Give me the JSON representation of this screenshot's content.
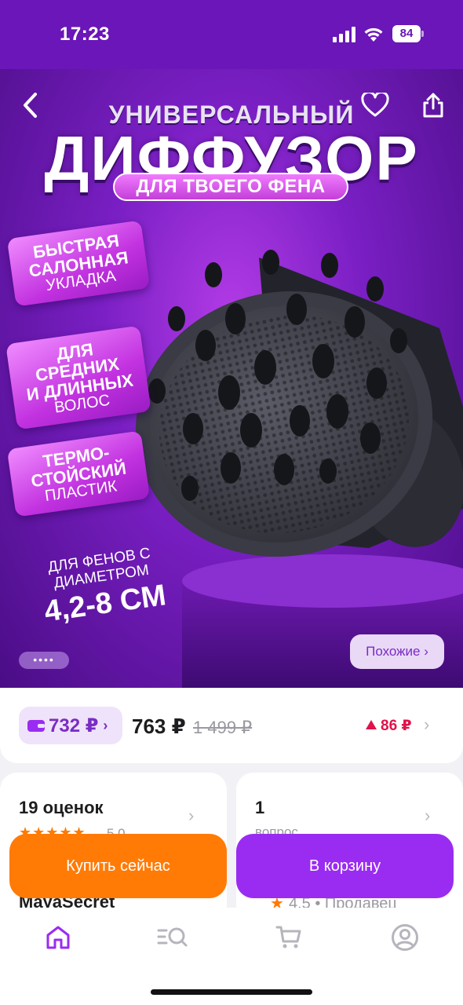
{
  "status_bar": {
    "time": "17:23",
    "battery": "84",
    "icons": [
      "cellular-signal-icon",
      "wifi-icon",
      "battery-icon"
    ]
  },
  "product_image": {
    "title_small": "УНИВЕРСАЛЬНЫЙ",
    "title_big": "ДИФФУЗОР",
    "title_pill": "ДЛЯ ТВОЕГО ФЕНА",
    "badges": [
      {
        "line1": "БЫСТРАЯ",
        "line2": "САЛОННАЯ",
        "line3": "УКЛАДКА"
      },
      {
        "line1": "ДЛЯ СРЕДНИХ",
        "line2": "И ДЛИННЫХ",
        "line3": "ВОЛОС"
      },
      {
        "line1": "ТЕРМО-",
        "line2": "СТОЙСКИЙ",
        "line3": "ПЛАСТИК"
      }
    ],
    "diameter_line1": "ДЛЯ ФЕНОВ С",
    "diameter_line2": "ДИАМЕТРОМ",
    "diameter_value": "4,2-8 СМ",
    "pager_dots": "••••",
    "similar_button": "Похожие ›"
  },
  "toolbar": {
    "back_icon": "back-arrow-icon",
    "favorite_icon": "heart-icon",
    "share_icon": "share-icon"
  },
  "price": {
    "wallet_price": "732 ₽",
    "price": "763 ₽",
    "old_price": "1 499 ₽",
    "rise": "86 ₽"
  },
  "reviews": {
    "count": "19 оценок",
    "stars": "★★★★★",
    "rating": "5.0"
  },
  "questions": {
    "count": "1",
    "label": "вопрос"
  },
  "seller": {
    "name": "MayaSecret",
    "rating": "4.5",
    "separator": "•",
    "label": "Продавец"
  },
  "actions": {
    "buy_now": "Купить сейчас",
    "add_to_cart": "В корзину"
  },
  "bottom_nav": {
    "items": [
      "home-icon",
      "catalog-search-icon",
      "cart-icon",
      "profile-icon"
    ]
  },
  "colors": {
    "purple_header": "#6a16b8",
    "accent_purple": "#9a2cf2",
    "buy_orange": "#ff7b05",
    "rise_red": "#e0124a",
    "star_orange": "#ff7a00"
  }
}
